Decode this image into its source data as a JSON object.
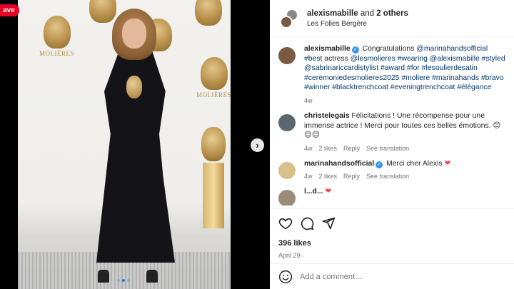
{
  "pin_badge": {
    "label": "ave"
  },
  "post": {
    "header": {
      "username": "alexismabille",
      "joiner": "and",
      "others": "2 others",
      "location": "Les Folies Bergère"
    },
    "backdrop_logo_text": "MOLIÈRES",
    "comments": [
      {
        "user": "alexismabille",
        "verified": true,
        "text_parts": [
          {
            "t": "Congratulations ",
            "tag": false
          },
          {
            "t": "@marinahandsofficial",
            "tag": true
          },
          {
            "t": " ",
            "tag": false
          },
          {
            "t": "#best",
            "tag": true
          },
          {
            "t": " actress ",
            "tag": false
          },
          {
            "t": "@lesmolieres",
            "tag": true
          },
          {
            "t": " ",
            "tag": false
          },
          {
            "t": "#wearing",
            "tag": true
          },
          {
            "t": " ",
            "tag": false
          },
          {
            "t": "@alexismabille",
            "tag": true
          },
          {
            "t": " ",
            "tag": false
          },
          {
            "t": "#styled",
            "tag": true
          },
          {
            "t": " ",
            "tag": false
          },
          {
            "t": "@sabrinariccardistylist",
            "tag": true
          },
          {
            "t": " ",
            "tag": false
          },
          {
            "t": "#award",
            "tag": true
          },
          {
            "t": " ",
            "tag": false
          },
          {
            "t": "#for",
            "tag": true
          },
          {
            "t": " ",
            "tag": false
          },
          {
            "t": "#lesoulierdesatin",
            "tag": true
          },
          {
            "t": " ",
            "tag": false
          },
          {
            "t": "#ceremoniedesmolieres2025",
            "tag": true
          },
          {
            "t": " ",
            "tag": false
          },
          {
            "t": "#moliere",
            "tag": true
          },
          {
            "t": " ",
            "tag": false
          },
          {
            "t": "#marinahands",
            "tag": true
          },
          {
            "t": " ",
            "tag": false
          },
          {
            "t": "#bravo",
            "tag": true
          },
          {
            "t": " ",
            "tag": false
          },
          {
            "t": "#winner",
            "tag": true
          },
          {
            "t": " ",
            "tag": false
          },
          {
            "t": "#blacktrenchcoat",
            "tag": true
          },
          {
            "t": " ",
            "tag": false
          },
          {
            "t": "#eveningtrenchcoat",
            "tag": true
          },
          {
            "t": " ",
            "tag": false
          },
          {
            "t": "#élégance",
            "tag": true
          }
        ],
        "time": "4w"
      },
      {
        "user": "christelegais",
        "verified": false,
        "text": "Félicitations ! Une récompense pour une immense actrice ! Merci pour toutes ces belles émotions. 😊😊😊",
        "time": "4w",
        "likes": "2 likes",
        "reply": "Reply",
        "translate": "See translation"
      },
      {
        "user": "marinahandsofficial",
        "verified": true,
        "text": "Merci cher Alexis",
        "heart": "❤",
        "time": "4w",
        "likes": "2 likes",
        "reply": "Reply",
        "translate": "See translation"
      }
    ],
    "partial_comment": {
      "user": "l...d...",
      "hearts": "❤"
    },
    "likes": "396 likes",
    "date": "April 29",
    "add_comment_placeholder": "Add a comment…",
    "emoji_icon": "smiley-icon",
    "next_icon": "chevron-right-icon"
  },
  "colors": {
    "link": "#00376b",
    "verified": "#3897f0",
    "heart": "#ed4956",
    "pin": "#e60023"
  }
}
